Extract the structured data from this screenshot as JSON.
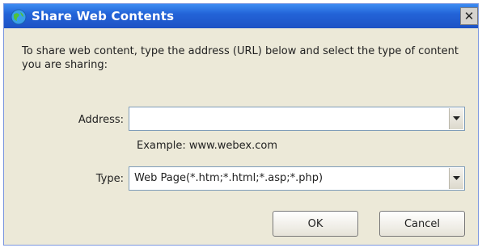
{
  "window": {
    "title": "Share Web Contents",
    "close_glyph": "✕",
    "icon": "globe-icon"
  },
  "instructions": "To share web content, type the address (URL) below and select the type of content you are sharing:",
  "address": {
    "label": "Address:",
    "value": "",
    "example": "Example: www.webex.com"
  },
  "type": {
    "label": "Type:",
    "selected": "Web Page(*.htm;*.html;*.asp;*.php)"
  },
  "buttons": {
    "ok": "OK",
    "cancel": "Cancel"
  },
  "colors": {
    "titlebar": "#2364d8",
    "dialog_background": "#ece9d8"
  }
}
